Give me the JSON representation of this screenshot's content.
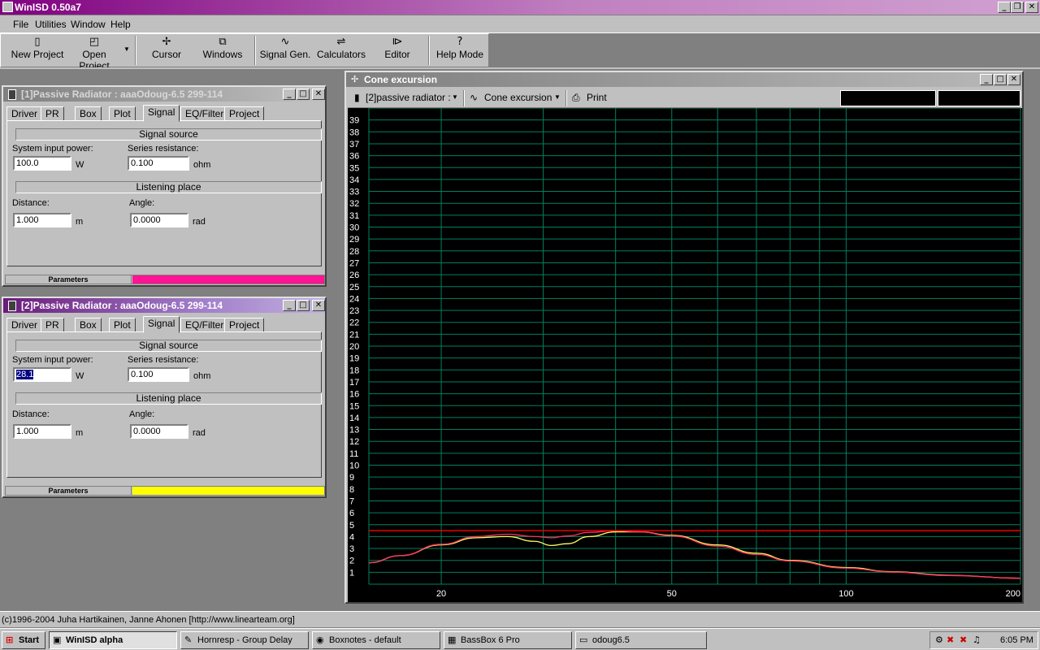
{
  "app": {
    "title": "WinISD 0.50a7"
  },
  "menu": [
    "File",
    "Utilities",
    "Window",
    "Help"
  ],
  "toolbar": [
    {
      "label": "New Project",
      "icon": "new-project-icon"
    },
    {
      "label": "Open Project",
      "icon": "open-project-icon"
    },
    {
      "label": "Cursor",
      "icon": "cursor-icon"
    },
    {
      "label": "Windows",
      "icon": "windows-icon"
    },
    {
      "label": "Signal Gen.",
      "icon": "signal-gen-icon"
    },
    {
      "label": "Calculators",
      "icon": "calculators-icon"
    },
    {
      "label": "Editor",
      "icon": "editor-icon"
    },
    {
      "label": "Help Mode",
      "icon": "help-mode-icon"
    }
  ],
  "panels": [
    {
      "title": "[1]Passive Radiator : aaaOdoug-6.5 299-114",
      "tabs": [
        "Driver",
        "PR",
        "Box",
        "Plot",
        "Signal",
        "EQ/Filter",
        "Project"
      ],
      "selected_tab": "Signal",
      "signal_source": "Signal source",
      "power_label": "System input power:",
      "power_value": "100.0",
      "power_unit": "W",
      "res_label": "Series resistance:",
      "res_value": "0.100",
      "res_unit": "ohm",
      "listening_place": "Listening place",
      "dist_label": "Distance:",
      "dist_value": "1.000",
      "dist_unit": "m",
      "angle_label": "Angle:",
      "angle_value": "0.0000",
      "angle_unit": "rad",
      "params_label": "Parameters",
      "color": "#ff1493"
    },
    {
      "title": "[2]Passive Radiator : aaaOdoug-6.5 299-114",
      "tabs": [
        "Driver",
        "PR",
        "Box",
        "Plot",
        "Signal",
        "EQ/Filter",
        "Project"
      ],
      "selected_tab": "Signal",
      "signal_source": "Signal source",
      "power_label": "System input power:",
      "power_value": "28.1",
      "power_unit": "W",
      "res_label": "Series resistance:",
      "res_value": "0.100",
      "res_unit": "ohm",
      "listening_place": "Listening place",
      "dist_label": "Distance:",
      "dist_value": "1.000",
      "dist_unit": "m",
      "angle_label": "Angle:",
      "angle_value": "0.0000",
      "angle_unit": "rad",
      "params_label": "Parameters",
      "color": "#ffff00"
    }
  ],
  "chart_window": {
    "title": "Cone excursion",
    "project_select": "[2]passive radiator :",
    "graph_select": "Cone excursion",
    "print_label": "Print"
  },
  "chart_data": {
    "type": "line",
    "x_scale": "log",
    "xlim": [
      15,
      200
    ],
    "ylim": [
      0,
      40
    ],
    "x_ticks": [
      20,
      50,
      100,
      200
    ],
    "y_ticks": [
      1,
      2,
      3,
      4,
      5,
      6,
      7,
      8,
      9,
      10,
      11,
      12,
      13,
      14,
      15,
      16,
      17,
      18,
      19,
      20,
      21,
      22,
      23,
      24,
      25,
      26,
      27,
      28,
      29,
      30,
      31,
      32,
      33,
      34,
      35,
      36,
      37,
      38,
      39
    ],
    "grid": true,
    "background": "#000000",
    "grid_color": "#008060",
    "series": [
      {
        "color": "#ffff60",
        "x": [
          15,
          17,
          20,
          23,
          26,
          29,
          31,
          33,
          36,
          40,
          44,
          50,
          60,
          70,
          80,
          100,
          120,
          150,
          200
        ],
        "y": [
          1.8,
          2.4,
          3.3,
          3.9,
          4.0,
          3.6,
          3.25,
          3.4,
          4.0,
          4.4,
          4.4,
          4.1,
          3.3,
          2.6,
          2.0,
          1.4,
          1.05,
          0.75,
          0.5
        ]
      },
      {
        "color": "#ff3060",
        "x": [
          15,
          17,
          20,
          23,
          26,
          29,
          31,
          33,
          36,
          40,
          44,
          50,
          60,
          70,
          80,
          100,
          120,
          150,
          200
        ],
        "y": [
          1.8,
          2.4,
          3.35,
          4.0,
          4.2,
          4.0,
          3.9,
          4.05,
          4.35,
          4.5,
          4.4,
          4.05,
          3.2,
          2.5,
          1.95,
          1.35,
          1.02,
          0.73,
          0.5
        ]
      },
      {
        "color": "#ff0000",
        "x": [
          15,
          200
        ],
        "y": [
          4.5,
          4.5
        ]
      }
    ]
  },
  "status": {
    "copyright": "(c)1996-2004 Juha Hartikainen, Janne Ahonen [http://www.linearteam.org]"
  },
  "taskbar": {
    "start": "Start",
    "items": [
      "WinISD alpha",
      "Hornresp - Group Delay",
      "Boxnotes - default",
      "BassBox 6 Pro",
      "odoug6.5"
    ],
    "time": "6:05 PM"
  }
}
